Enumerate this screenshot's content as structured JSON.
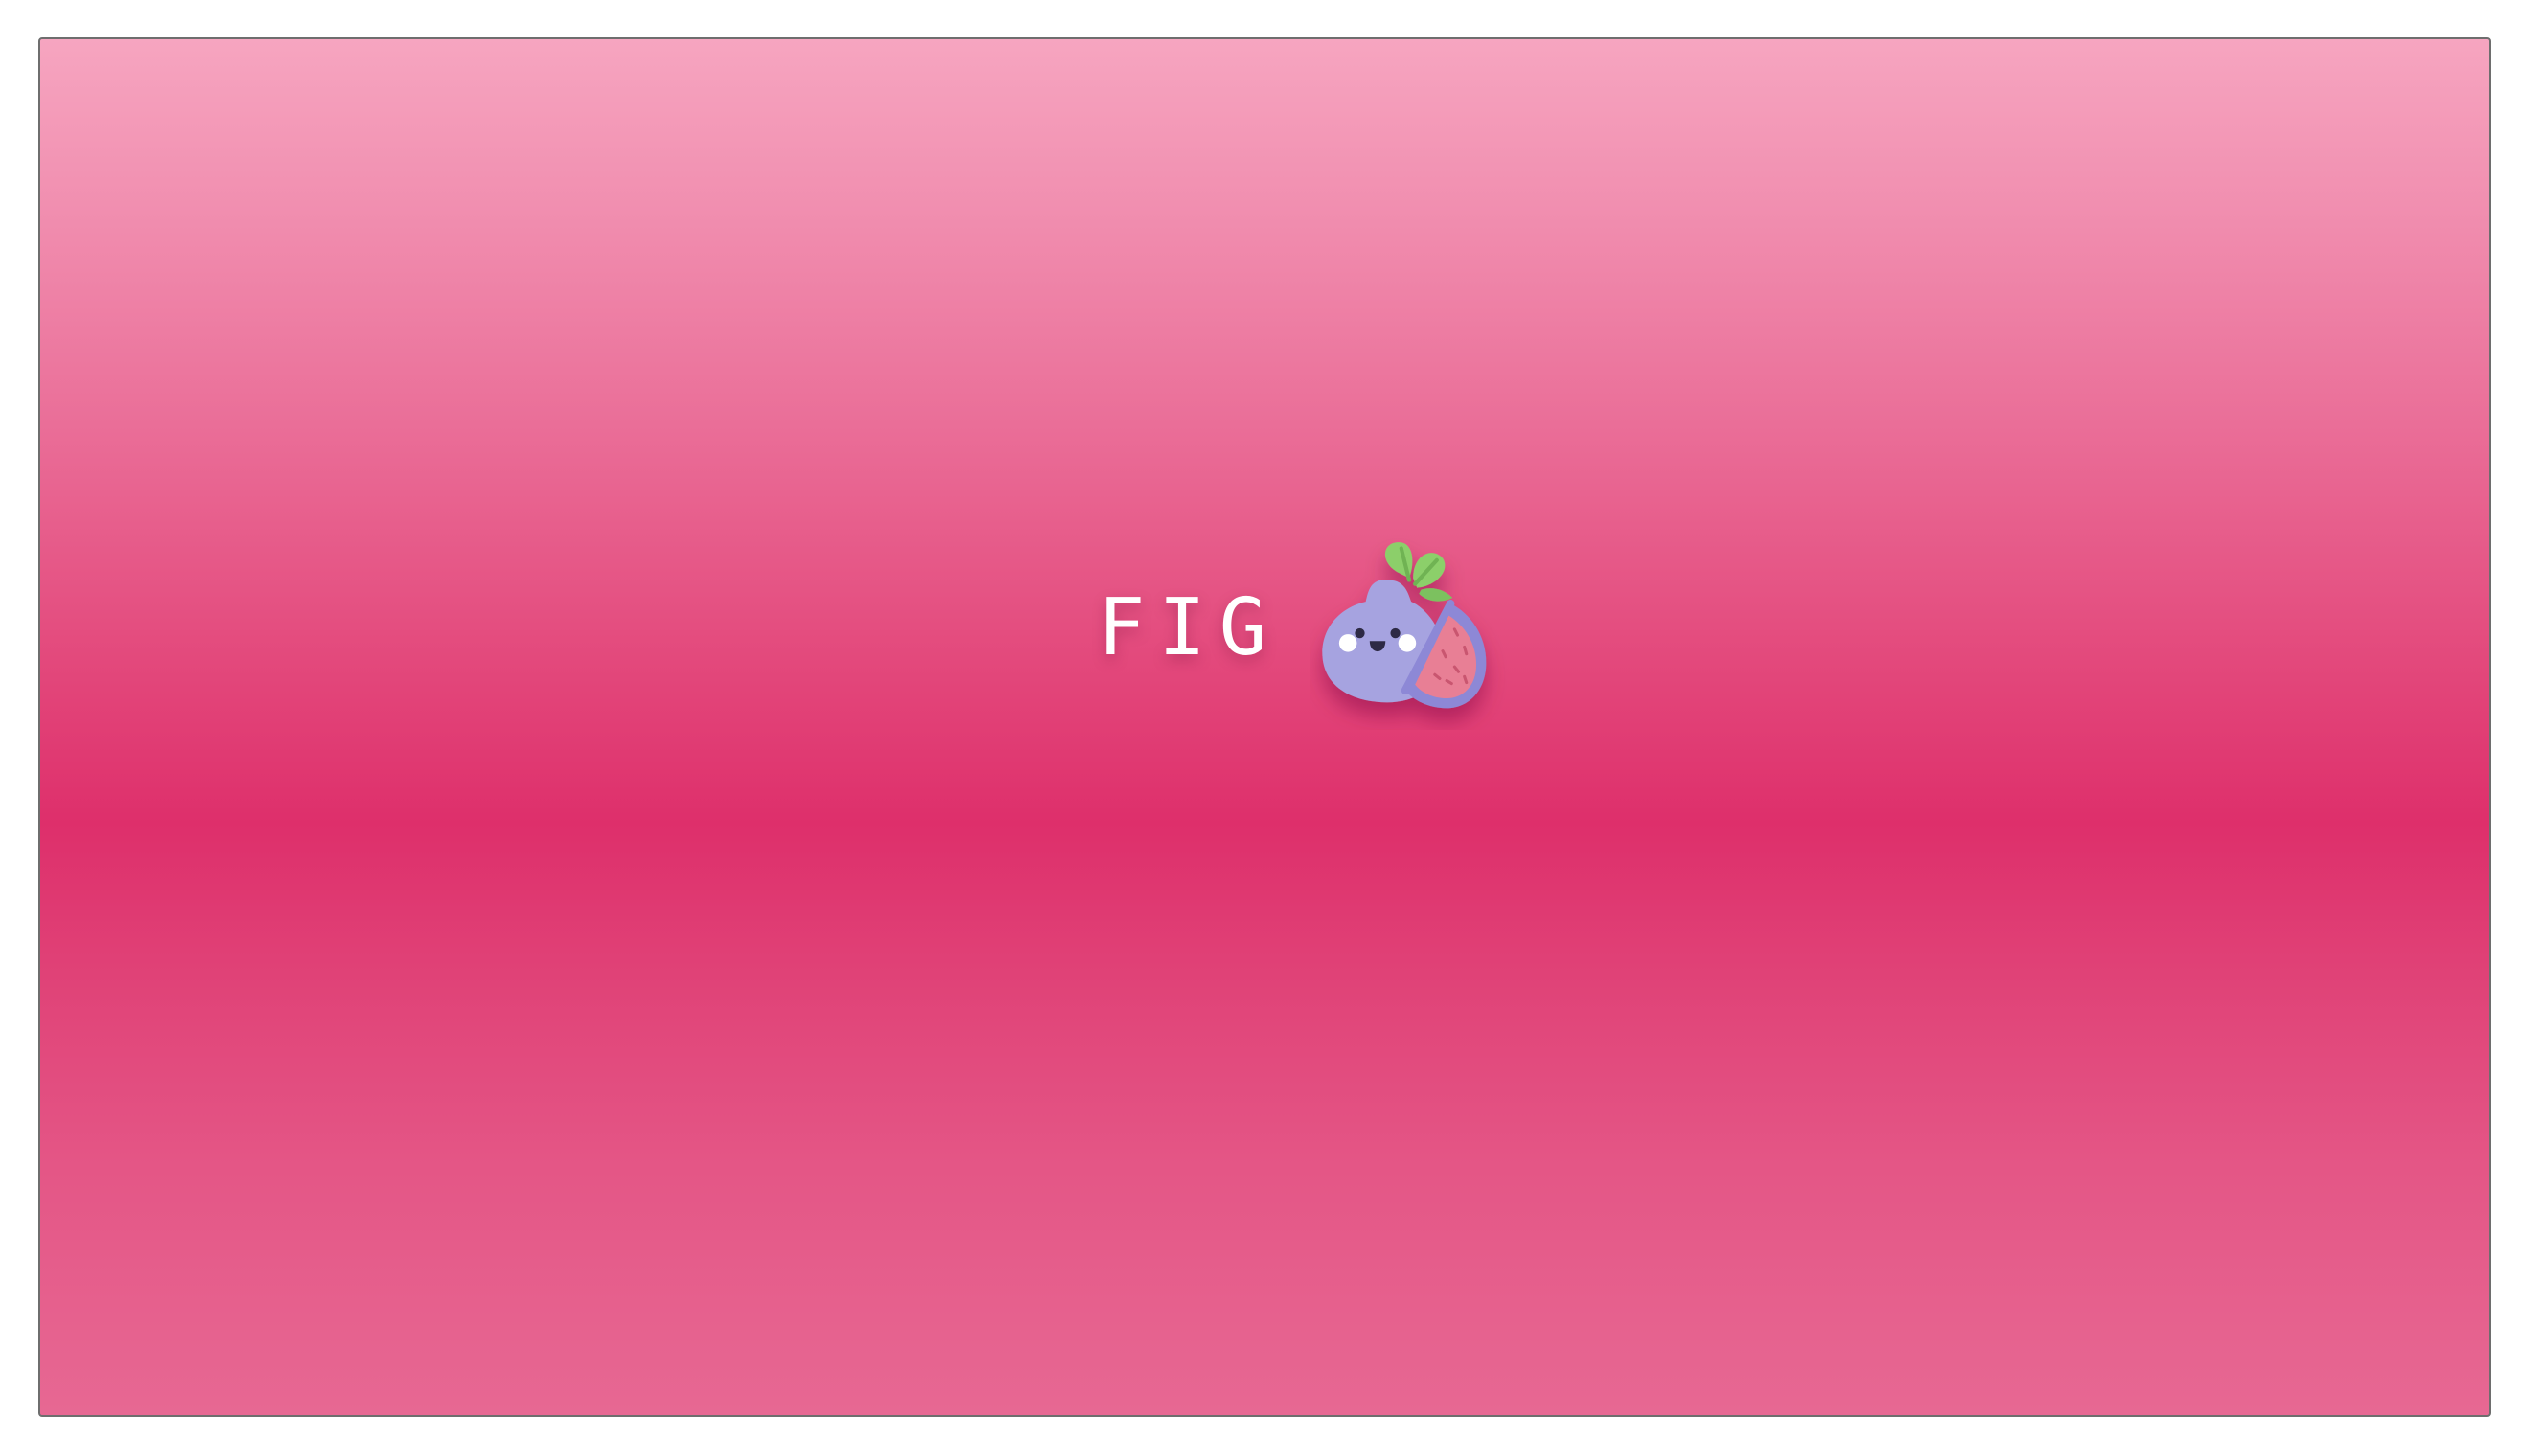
{
  "logo": {
    "text": "FIG",
    "icon": "fig-mascot-icon"
  },
  "colors": {
    "background_top": "#f6a5c0",
    "background_middle": "#de2f6b",
    "background_bottom": "#e76893",
    "text": "#ffffff",
    "fig_body": "#a6a3e0",
    "fig_flesh": "#e87f95",
    "fig_leaf": "#8ccf6b"
  }
}
